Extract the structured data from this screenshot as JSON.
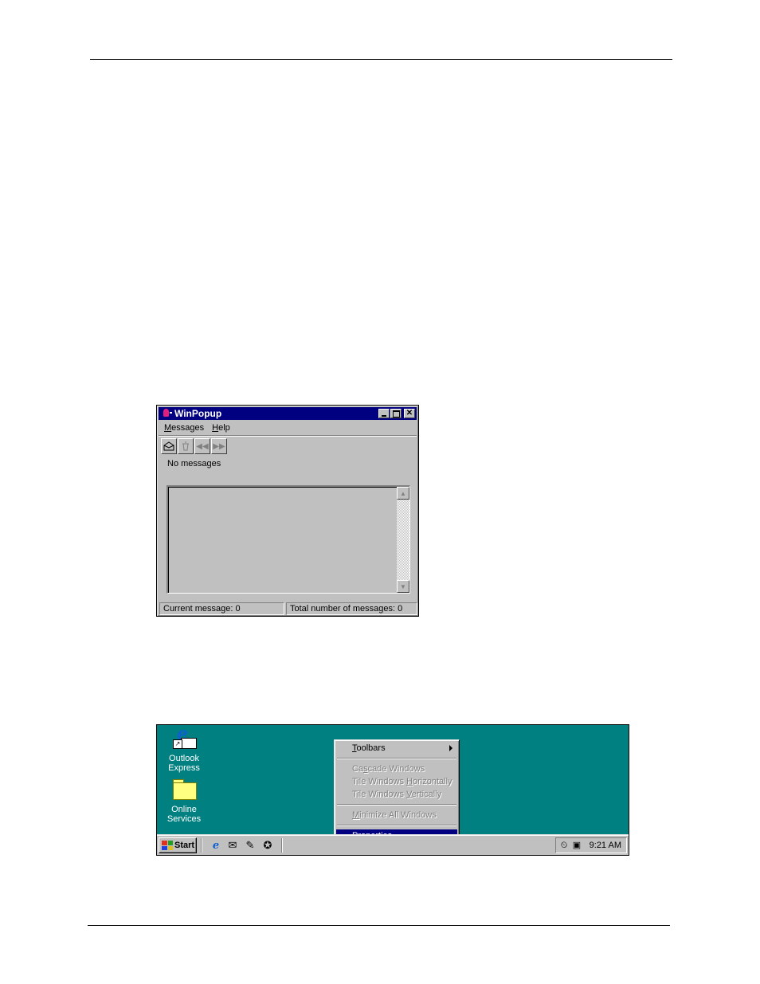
{
  "winpopup": {
    "title": "WinPopup",
    "menu": [
      {
        "label": "Messages",
        "key": "M",
        "rest": "essages"
      },
      {
        "label": "Help",
        "key": "H",
        "rest": "elp"
      }
    ],
    "toolbar_icons": [
      "envelope-icon",
      "trash-icon",
      "previous-icon",
      "next-icon"
    ],
    "status_text": "No messages",
    "statusbar": {
      "current": "Current message: 0",
      "total": "Total number of messages: 0"
    }
  },
  "desktop": {
    "background_color": "#008080",
    "icons": [
      {
        "line1": "Outlook",
        "line2": "Express",
        "icon": "outlook-express-icon"
      },
      {
        "line1": "Online",
        "line2": "Services",
        "icon": "folder-icon"
      }
    ],
    "context_menu": {
      "items": [
        {
          "pre": "",
          "key": "T",
          "post": "oolbars",
          "disabled": false,
          "submenu": true
        },
        {
          "pre": "Ca",
          "key": "s",
          "post": "cade Windows",
          "disabled": true
        },
        {
          "pre": "Tile Windows ",
          "key": "H",
          "post": "orizontally",
          "disabled": true
        },
        {
          "pre": "Tile Windows ",
          "key": "V",
          "post": "ertically",
          "disabled": true
        },
        {
          "pre": "",
          "key": "M",
          "post": "inimize All Windows",
          "disabled": true
        },
        {
          "pre": "P",
          "key": "r",
          "post": "operties",
          "selected": true
        }
      ]
    },
    "taskbar": {
      "start_label": "Start",
      "quick_launch": [
        "internet-explorer-icon",
        "outlook-express-icon",
        "show-desktop-icon",
        "channels-icon"
      ],
      "clock": "9:21 AM"
    }
  }
}
